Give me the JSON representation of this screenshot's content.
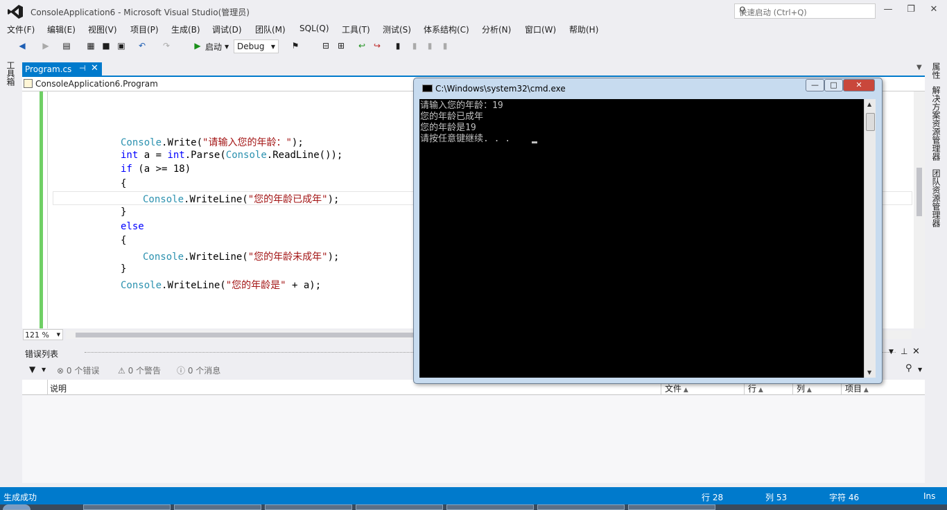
{
  "window": {
    "title": "ConsoleApplication6 - Microsoft Visual Studio(管理员)",
    "quick_launch_placeholder": "快速启动 (Ctrl+Q)",
    "minimize": "—",
    "restore": "❐",
    "close": "✕"
  },
  "menu": [
    "文件(F)",
    "编辑(E)",
    "视图(V)",
    "项目(P)",
    "生成(B)",
    "调试(D)",
    "团队(M)",
    "SQL(Q)",
    "工具(T)",
    "测试(S)",
    "体系结构(C)",
    "分析(N)",
    "窗口(W)",
    "帮助(H)"
  ],
  "toolbar": {
    "start_label": "启动",
    "config_value": "Debug"
  },
  "left_strip": {
    "toolbox": "工具箱"
  },
  "right_strip": {
    "properties": "属性",
    "solution_explorer": "解决方案资源管理器",
    "team_explorer": "团队资源管理器"
  },
  "document_tab": {
    "label": "Program.cs",
    "pin": "⊣"
  },
  "navbar": {
    "class_path": "ConsoleApplication6.Program"
  },
  "code": {
    "l1": {
      "a": "Console",
      "b": ".Write(",
      "c": "\"请输入您的年龄：\"",
      "d": ");"
    },
    "l2": {
      "a": "int",
      "b": " a = ",
      "c": "int",
      "d": ".Parse(",
      "e": "Console",
      "f": ".ReadLine());"
    },
    "l3": {
      "a": "if",
      "b": " (a >= 18)"
    },
    "l4": "{",
    "l5": {
      "a": "Console",
      "b": ".WriteLine(",
      "c": "\"您的年龄已成年\"",
      "d": ");"
    },
    "l6": "}",
    "l7": "else",
    "l8": "{",
    "l9": {
      "a": "Console",
      "b": ".WriteLine(",
      "c": "\"您的年龄未成年\"",
      "d": ");"
    },
    "l10": "}",
    "l11": {
      "a": "Console",
      "b": ".WriteLine(",
      "c": "\"您的年龄是\"",
      "d": " + a);"
    }
  },
  "zoom": "121 %",
  "error_list": {
    "title": "错误列表",
    "errors": "0 个错误",
    "warnings": "0 个警告",
    "messages": "0 个消息",
    "columns": {
      "desc": "说明",
      "file": "文件",
      "line": "行",
      "col": "列",
      "project": "项目"
    }
  },
  "status": {
    "message": "生成成功",
    "line": "行 28",
    "col": "列 53",
    "char": "字符 46",
    "mode": "Ins"
  },
  "cmd": {
    "title": "C:\\Windows\\system32\\cmd.exe",
    "lines": [
      "请输入您的年龄：19",
      "您的年龄已成年",
      "您的年龄是19",
      "请按任意键继续. . . "
    ]
  },
  "colors": {
    "accent": "#007acc",
    "cmd_bg": "#000000",
    "margin_green": "#6fcf65"
  }
}
